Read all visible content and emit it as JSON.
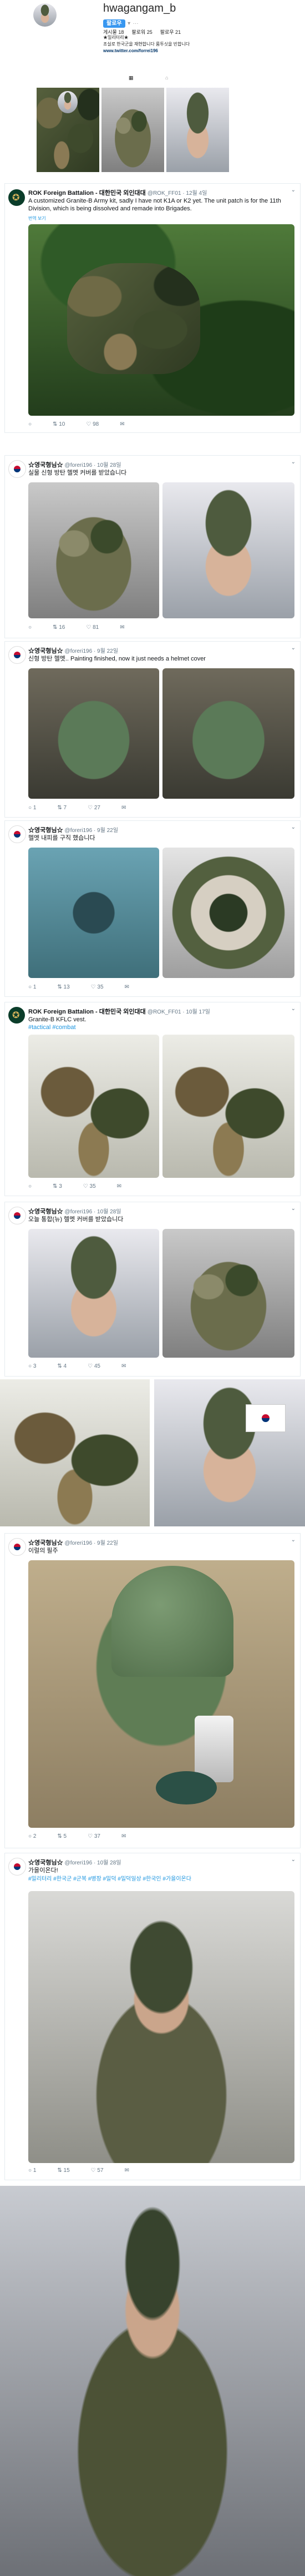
{
  "profile": {
    "username": "hwagangam_b",
    "follow_label": "팔로우",
    "stats": [
      "게시물 18",
      "팔로워 25",
      "팔로우 21"
    ],
    "bio_lines": [
      "★밀리터리★",
      "조실로 한국군을 재현합니다 룸투싯을 빈합니다",
      "www.twitter.com/forrei196"
    ],
    "tab_icons": [
      "grid-icon",
      "tag-icon"
    ]
  },
  "tweets": [
    {
      "author": "ROK Foreign Battalion - 대한민국 외인대대",
      "handle": "@ROK_FF01 · 12월 4일",
      "text": "A customized Granite-B Army kit, sadly I have not K1A or K2 yet. The unit patch is for the 11th Division, which is being dissolved and remade into Brigades.",
      "translate": "번역 보기",
      "actions": [
        "○",
        "⇅ 10",
        "♡ 98",
        "✉"
      ]
    },
    {
      "author": "☆영국형님☆",
      "handle": "@foreri196 · 10월 28일",
      "text": "실물 신형 방탄 헬멧 커버를 받았습니다",
      "actions": [
        "○",
        "⇅ 16",
        "♡ 81",
        "✉"
      ]
    },
    {
      "author": "☆영국형님☆",
      "handle": "@foreri196 · 9월 22일",
      "text": "신형 방탄 헬멧.. Painting finished, now it just needs a helmet cover",
      "actions": [
        "○ 1",
        "⇅ 7",
        "♡ 27",
        "✉"
      ]
    },
    {
      "author": "☆영국형님☆",
      "handle": "@foreri196 · 9월 22일",
      "text": "헬멧 내피를 구직 했습니다",
      "actions": [
        "○ 1",
        "⇅ 13",
        "♡ 35",
        "✉"
      ]
    },
    {
      "author": "ROK Foreign Battalion - 대한민국 외인대대",
      "handle": "@ROK_FF01 · 10월 17일",
      "text": "Granite-B KFLC vest.",
      "hashtag": "#tactical #combat",
      "actions": [
        "○",
        "⇅ 3",
        "♡ 35",
        "✉"
      ]
    },
    {
      "author": "☆영국형님☆",
      "handle": "@foreri196 · 10월 28일",
      "text": "오늘 통합(뉴) 헬멧 커버를 받았습니다",
      "actions": [
        "○ 3",
        "⇅ 4",
        "♡ 45",
        "✉"
      ]
    },
    {
      "author": "☆영국형님☆",
      "handle": "@foreri196 · 9월 22일",
      "text": "이럴의 필주",
      "actions": [
        "○ 2",
        "⇅ 5",
        "♡ 37",
        "✉"
      ]
    },
    {
      "author": "☆영국형님☆",
      "handle": "@foreri196 · 10월 28일",
      "text": "가을이온다!",
      "hashtag": "#밀리터리 #한국군 #군복 #병장 #밀덕 #밀덕일상 #한국인 #가을이온다",
      "actions": [
        "○ 1",
        "⇅ 15",
        "♡ 57",
        "✉"
      ]
    }
  ],
  "colors": {
    "link": "#1b95e0",
    "follow": "#3897f0",
    "border": "#e6ecf0"
  }
}
